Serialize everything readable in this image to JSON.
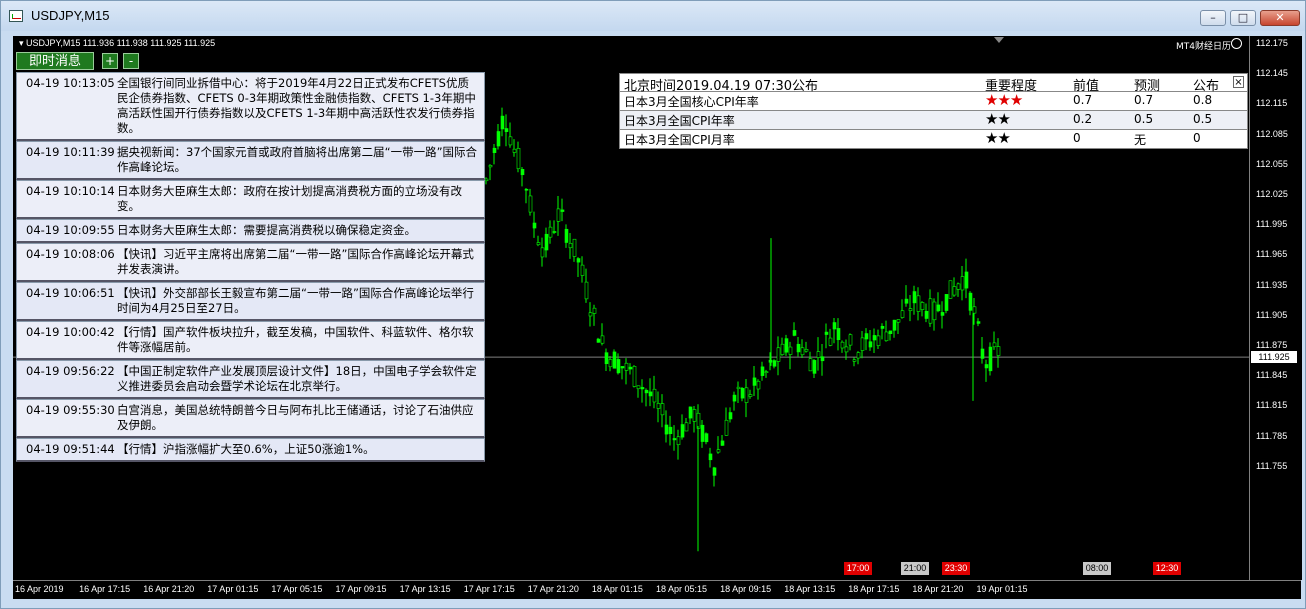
{
  "window": {
    "title": "USDJPY,M15",
    "min": "–",
    "max": "□",
    "close": "✕"
  },
  "chart": {
    "symbol_info": "▾ USDJPY,M15  111.936 111.938 111.925 111.925",
    "plugin_label": "MT4财经日历",
    "current_price": "111.925",
    "price_ticks": [
      "112.175",
      "112.145",
      "112.115",
      "112.085",
      "112.055",
      "112.025",
      "111.995",
      "111.965",
      "111.935",
      "111.905",
      "111.875",
      "111.845",
      "111.815",
      "111.785",
      "111.755"
    ],
    "time_ticks": [
      "16 Apr 2019",
      "16 Apr 17:15",
      "16 Apr 21:20",
      "17 Apr 01:15",
      "17 Apr 05:15",
      "17 Apr 09:15",
      "17 Apr 13:15",
      "17 Apr 17:15",
      "17 Apr 21:20",
      "18 Apr 01:15",
      "18 Apr 05:15",
      "18 Apr 09:15",
      "18 Apr 13:15",
      "18 Apr 17:15",
      "18 Apr 21:20",
      "19 Apr 01:15"
    ],
    "event_markers": [
      {
        "label": "17:00",
        "kind": "red"
      },
      {
        "label": "21:00",
        "kind": "gray"
      },
      {
        "label": "23:30",
        "kind": "red"
      },
      {
        "label": "08:00",
        "kind": "gray"
      },
      {
        "label": "12:30",
        "kind": "red"
      }
    ],
    "colors": {
      "candle": "#00ff00",
      "background": "#000000",
      "price_line": "#808080"
    }
  },
  "news": {
    "tab_label": "即时消息",
    "plus_label": "+",
    "minus_label": "-",
    "items": [
      {
        "time": "04-19 10:13:05",
        "text": "全国银行间同业拆借中心：将于2019年4月22日正式发布CFETS优质民企债券指数、CFETS 0-3年期政策性金融债指数、CFETS 1-3年期中高活跃性国开行债券指数以及CFETS 1-3年期中高活跃性农发行债券指数。"
      },
      {
        "time": "04-19 10:11:39",
        "text": "据央视新闻：37个国家元首或政府首脑将出席第二届“一带一路”国际合作高峰论坛。"
      },
      {
        "time": "04-19 10:10:14",
        "text": "日本财务大臣麻生太郎：政府在按计划提高消费税方面的立场没有改变。"
      },
      {
        "time": "04-19 10:09:55",
        "text": "日本财务大臣麻生太郎：需要提高消费税以确保稳定资金。"
      },
      {
        "time": "04-19 10:08:06",
        "text": "【快讯】习近平主席将出席第二届“一带一路”国际合作高峰论坛开幕式并发表演讲。"
      },
      {
        "time": "04-19 10:06:51",
        "text": "【快讯】外交部部长王毅宣布第二届“一带一路”国际合作高峰论坛举行时间为4月25日至27日。"
      },
      {
        "time": "04-19 10:00:42",
        "text": "【行情】国产软件板块拉升，截至发稿，中国软件、科蓝软件、格尔软件等涨幅居前。"
      },
      {
        "time": "04-19 09:56:22",
        "text": "【中国正制定软件产业发展顶层设计文件】18日，中国电子学会软件定义推进委员会启动会暨学术论坛在北京举行。"
      },
      {
        "time": "04-19 09:55:30",
        "text": "白宫消息，美国总统特朗普今日与阿布扎比王储通话，讨论了石油供应及伊朗。"
      },
      {
        "time": "04-19 09:51:44",
        "text": "【行情】沪指涨幅扩大至0.6%，上证50涨逾1%。"
      }
    ]
  },
  "calendar": {
    "header": {
      "title": "北京时间2019.04.19 07:30公布",
      "importance": "重要程度",
      "previous": "前值",
      "forecast": "预测",
      "actual": "公布",
      "close": "×"
    },
    "rows": [
      {
        "name": "日本3月全国核心CPI年率",
        "stars": "★★★",
        "star_color": "red",
        "previous": "0.7",
        "forecast": "0.7",
        "actual": "0.8"
      },
      {
        "name": "日本3月全国CPI年率",
        "stars": "★★",
        "star_color": "black",
        "previous": "0.2",
        "forecast": "0.5",
        "actual": "0.5"
      },
      {
        "name": "日本3月全国CPI月率",
        "stars": "★★",
        "star_color": "black",
        "previous": "0",
        "forecast": "无",
        "actual": "0"
      }
    ]
  }
}
